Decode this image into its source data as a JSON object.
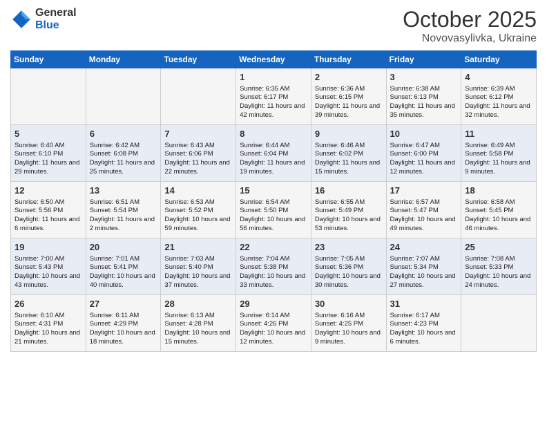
{
  "logo": {
    "general": "General",
    "blue": "Blue"
  },
  "header": {
    "month": "October 2025",
    "location": "Novovasylivka, Ukraine"
  },
  "weekdays": [
    "Sunday",
    "Monday",
    "Tuesday",
    "Wednesday",
    "Thursday",
    "Friday",
    "Saturday"
  ],
  "weeks": [
    [
      {
        "day": "",
        "text": ""
      },
      {
        "day": "",
        "text": ""
      },
      {
        "day": "",
        "text": ""
      },
      {
        "day": "1",
        "text": "Sunrise: 6:35 AM\nSunset: 6:17 PM\nDaylight: 11 hours and 42 minutes."
      },
      {
        "day": "2",
        "text": "Sunrise: 6:36 AM\nSunset: 6:15 PM\nDaylight: 11 hours and 39 minutes."
      },
      {
        "day": "3",
        "text": "Sunrise: 6:38 AM\nSunset: 6:13 PM\nDaylight: 11 hours and 35 minutes."
      },
      {
        "day": "4",
        "text": "Sunrise: 6:39 AM\nSunset: 6:12 PM\nDaylight: 11 hours and 32 minutes."
      }
    ],
    [
      {
        "day": "5",
        "text": "Sunrise: 6:40 AM\nSunset: 6:10 PM\nDaylight: 11 hours and 29 minutes."
      },
      {
        "day": "6",
        "text": "Sunrise: 6:42 AM\nSunset: 6:08 PM\nDaylight: 11 hours and 25 minutes."
      },
      {
        "day": "7",
        "text": "Sunrise: 6:43 AM\nSunset: 6:06 PM\nDaylight: 11 hours and 22 minutes."
      },
      {
        "day": "8",
        "text": "Sunrise: 6:44 AM\nSunset: 6:04 PM\nDaylight: 11 hours and 19 minutes."
      },
      {
        "day": "9",
        "text": "Sunrise: 6:46 AM\nSunset: 6:02 PM\nDaylight: 11 hours and 15 minutes."
      },
      {
        "day": "10",
        "text": "Sunrise: 6:47 AM\nSunset: 6:00 PM\nDaylight: 11 hours and 12 minutes."
      },
      {
        "day": "11",
        "text": "Sunrise: 6:49 AM\nSunset: 5:58 PM\nDaylight: 11 hours and 9 minutes."
      }
    ],
    [
      {
        "day": "12",
        "text": "Sunrise: 6:50 AM\nSunset: 5:56 PM\nDaylight: 11 hours and 6 minutes."
      },
      {
        "day": "13",
        "text": "Sunrise: 6:51 AM\nSunset: 5:54 PM\nDaylight: 11 hours and 2 minutes."
      },
      {
        "day": "14",
        "text": "Sunrise: 6:53 AM\nSunset: 5:52 PM\nDaylight: 10 hours and 59 minutes."
      },
      {
        "day": "15",
        "text": "Sunrise: 6:54 AM\nSunset: 5:50 PM\nDaylight: 10 hours and 56 minutes."
      },
      {
        "day": "16",
        "text": "Sunrise: 6:55 AM\nSunset: 5:49 PM\nDaylight: 10 hours and 53 minutes."
      },
      {
        "day": "17",
        "text": "Sunrise: 6:57 AM\nSunset: 5:47 PM\nDaylight: 10 hours and 49 minutes."
      },
      {
        "day": "18",
        "text": "Sunrise: 6:58 AM\nSunset: 5:45 PM\nDaylight: 10 hours and 46 minutes."
      }
    ],
    [
      {
        "day": "19",
        "text": "Sunrise: 7:00 AM\nSunset: 5:43 PM\nDaylight: 10 hours and 43 minutes."
      },
      {
        "day": "20",
        "text": "Sunrise: 7:01 AM\nSunset: 5:41 PM\nDaylight: 10 hours and 40 minutes."
      },
      {
        "day": "21",
        "text": "Sunrise: 7:03 AM\nSunset: 5:40 PM\nDaylight: 10 hours and 37 minutes."
      },
      {
        "day": "22",
        "text": "Sunrise: 7:04 AM\nSunset: 5:38 PM\nDaylight: 10 hours and 33 minutes."
      },
      {
        "day": "23",
        "text": "Sunrise: 7:05 AM\nSunset: 5:36 PM\nDaylight: 10 hours and 30 minutes."
      },
      {
        "day": "24",
        "text": "Sunrise: 7:07 AM\nSunset: 5:34 PM\nDaylight: 10 hours and 27 minutes."
      },
      {
        "day": "25",
        "text": "Sunrise: 7:08 AM\nSunset: 5:33 PM\nDaylight: 10 hours and 24 minutes."
      }
    ],
    [
      {
        "day": "26",
        "text": "Sunrise: 6:10 AM\nSunset: 4:31 PM\nDaylight: 10 hours and 21 minutes."
      },
      {
        "day": "27",
        "text": "Sunrise: 6:11 AM\nSunset: 4:29 PM\nDaylight: 10 hours and 18 minutes."
      },
      {
        "day": "28",
        "text": "Sunrise: 6:13 AM\nSunset: 4:28 PM\nDaylight: 10 hours and 15 minutes."
      },
      {
        "day": "29",
        "text": "Sunrise: 6:14 AM\nSunset: 4:26 PM\nDaylight: 10 hours and 12 minutes."
      },
      {
        "day": "30",
        "text": "Sunrise: 6:16 AM\nSunset: 4:25 PM\nDaylight: 10 hours and 9 minutes."
      },
      {
        "day": "31",
        "text": "Sunrise: 6:17 AM\nSunset: 4:23 PM\nDaylight: 10 hours and 6 minutes."
      },
      {
        "day": "",
        "text": ""
      }
    ]
  ]
}
